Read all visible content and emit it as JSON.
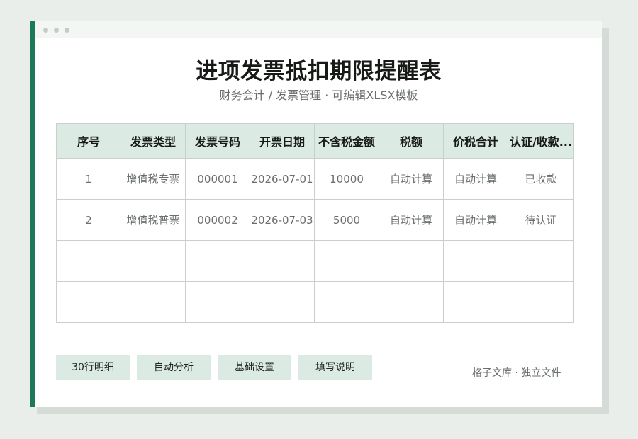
{
  "title": "进项发票抵扣期限提醒表",
  "subtitle": "财务会计 / 发票管理 · 可编辑XLSX模板",
  "table": {
    "headers": [
      "序号",
      "发票类型",
      "发票号码",
      "开票日期",
      "不含税金额",
      "税额",
      "价税合计",
      "认证/收款..."
    ],
    "rows": [
      [
        "1",
        "增值税专票",
        "000001",
        "2026-07-01",
        "10000",
        "自动计算",
        "自动计算",
        "已收款"
      ],
      [
        "2",
        "增值税普票",
        "000002",
        "2026-07-03",
        "5000",
        "自动计算",
        "自动计算",
        "待认证"
      ],
      [
        "",
        "",
        "",
        "",
        "",
        "",
        "",
        ""
      ],
      [
        "",
        "",
        "",
        "",
        "",
        "",
        "",
        ""
      ]
    ]
  },
  "tabs": [
    {
      "label": "30行明细"
    },
    {
      "label": "自动分析"
    },
    {
      "label": "基础设置"
    },
    {
      "label": "填写说明"
    }
  ],
  "footer": "格子文库 · 独立文件",
  "colors": {
    "accent": "#1c7a58",
    "header_fill": "#dbeae2",
    "background": "#eaeeea"
  }
}
